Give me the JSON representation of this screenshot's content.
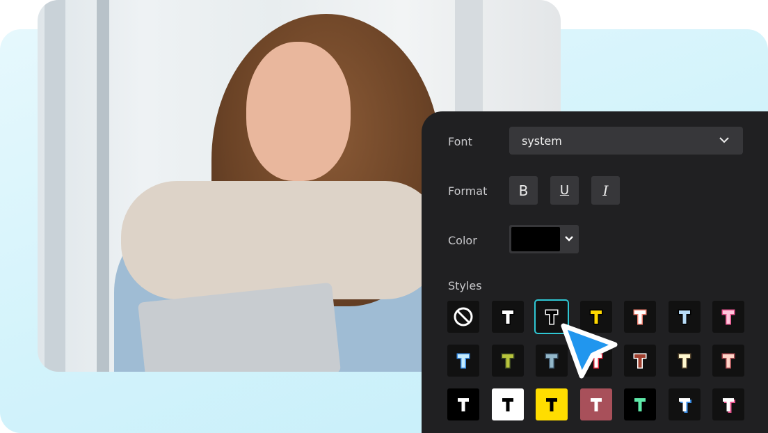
{
  "panel": {
    "font": {
      "label": "Font",
      "value": "system"
    },
    "format": {
      "label": "Format",
      "buttons": [
        {
          "name": "bold",
          "glyph": "B"
        },
        {
          "name": "underline",
          "glyph": "U"
        },
        {
          "name": "italic",
          "glyph": "I"
        }
      ]
    },
    "color": {
      "label": "Color",
      "value": "#000000"
    },
    "styles": {
      "label": "Styles",
      "selected_index": 2,
      "tiles": [
        {
          "type": "none"
        },
        {
          "bg": "#111111",
          "fill": "#ffffff",
          "stroke": "#000000"
        },
        {
          "bg": "#111111",
          "fill": "#000000",
          "stroke": "#ffffff"
        },
        {
          "bg": "#111111",
          "fill": "#ffd800",
          "stroke": "#000000"
        },
        {
          "bg": "#111111",
          "fill": "#ffffff",
          "stroke": "#ef7f6f"
        },
        {
          "bg": "#111111",
          "fill": "#b8dcf7",
          "stroke": "#000000"
        },
        {
          "bg": "#111111",
          "fill": "#ffc6dc",
          "stroke": "#e8538e"
        },
        {
          "bg": "#111111",
          "fill": "#c4ecff",
          "stroke": "#3a8ee8"
        },
        {
          "bg": "#111111",
          "fill": "#b8c43c",
          "stroke": "#3d4a22"
        },
        {
          "bg": "#111111",
          "fill": "#93b7c9",
          "stroke": "#3b5468"
        },
        {
          "bg": "#111111",
          "fill": "#ffffff",
          "stroke": "#e0253a"
        },
        {
          "bg": "#111111",
          "fill": "#a0402f",
          "stroke": "#ffffff"
        },
        {
          "bg": "#111111",
          "fill": "#fff8cf",
          "stroke": "#5c4a30"
        },
        {
          "bg": "#111111",
          "fill": "#ffd4c8",
          "stroke": "#a8484e"
        },
        {
          "bg": "#000000",
          "fill": "#ffffff",
          "stroke": "none"
        },
        {
          "bg": "#ffffff",
          "fill": "#000000",
          "stroke": "none"
        },
        {
          "bg": "#ffdd00",
          "fill": "#000000",
          "stroke": "none"
        },
        {
          "bg": "#a8505a",
          "fill": "#ffffff",
          "stroke": "none"
        },
        {
          "bg": "#000000",
          "fill": "#5ee8a8",
          "stroke": "none"
        },
        {
          "bg": "#111111",
          "fill": "#ffffff",
          "stroke": "none",
          "shadow": "#3a8ee8"
        },
        {
          "bg": "#111111",
          "fill": "#ffffff",
          "stroke": "none",
          "shadow": "#e8538e"
        }
      ]
    }
  },
  "colors": {
    "panel_bg": "#202022",
    "control_bg": "#37373a",
    "accent": "#2fc7d4",
    "cursor": "#2196ee"
  }
}
